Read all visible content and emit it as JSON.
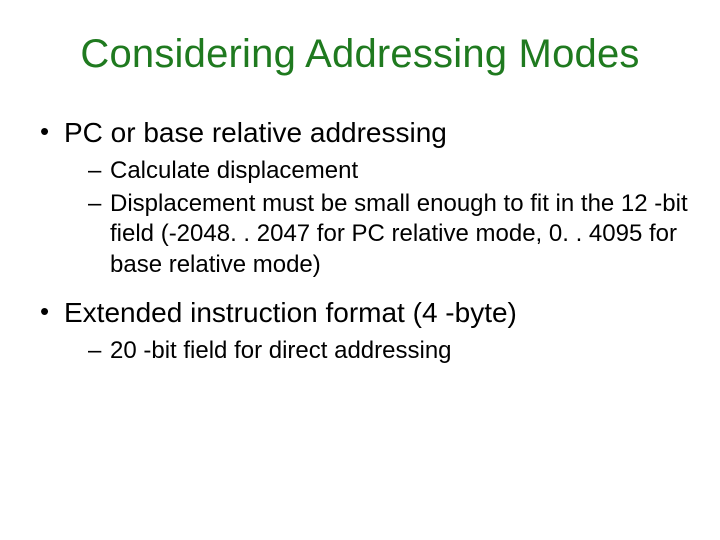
{
  "title": "Considering Addressing Modes",
  "bullets": [
    {
      "text": "PC or base relative addressing",
      "sub": [
        "Calculate displacement",
        "Displacement must be small enough to fit in the 12 -bit field (-2048. . 2047 for PC relative mode, 0. . 4095 for base relative mode)"
      ]
    },
    {
      "text": "Extended instruction format (4 -byte)",
      "sub": [
        "20 -bit field for direct addressing"
      ]
    }
  ]
}
